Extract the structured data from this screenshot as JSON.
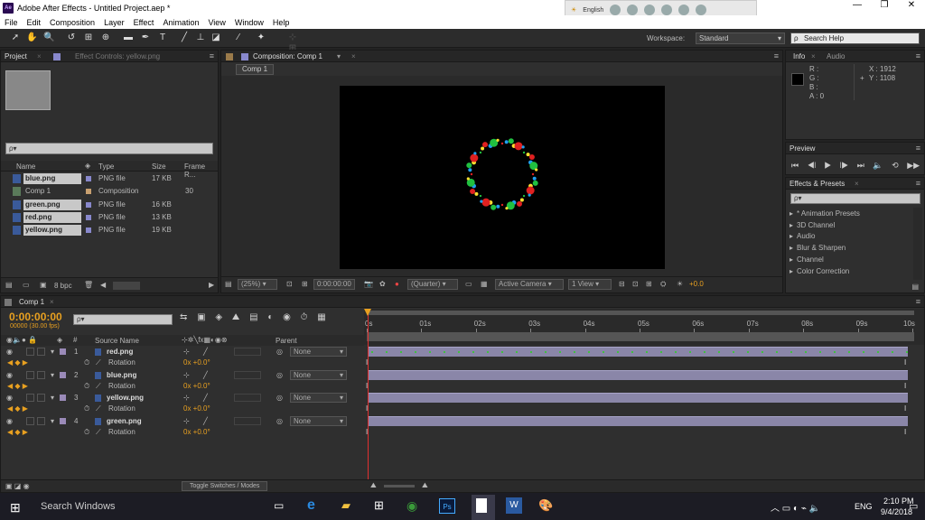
{
  "window": {
    "title": "Adobe After Effects - Untitled Project.aep *",
    "app_icon": "Ae"
  },
  "lang_bar": {
    "language": "English"
  },
  "menu": [
    "File",
    "Edit",
    "Composition",
    "Layer",
    "Effect",
    "Animation",
    "View",
    "Window",
    "Help"
  ],
  "toolbar": {
    "workspace_label": "Workspace:",
    "workspace_value": "Standard",
    "search_help": "Search Help"
  },
  "project_panel": {
    "tab_project": "Project",
    "tab_effect_controls": "Effect Controls: yellow.png",
    "search_placeholder": "ρ▾",
    "columns": {
      "name": "Name",
      "type": "Type",
      "size": "Size",
      "frame_rate": "Frame R..."
    },
    "items": [
      {
        "name": "blue.png",
        "type": "PNG file",
        "size": "17 KB",
        "fr": ""
      },
      {
        "name": "Comp 1",
        "type": "Composition",
        "size": "",
        "fr": "30"
      },
      {
        "name": "green.png",
        "type": "PNG file",
        "size": "16 KB",
        "fr": ""
      },
      {
        "name": "red.png",
        "type": "PNG file",
        "size": "13 KB",
        "fr": ""
      },
      {
        "name": "yellow.png",
        "type": "PNG file",
        "size": "19 KB",
        "fr": ""
      }
    ],
    "bpc": "8 bpc"
  },
  "comp_panel": {
    "tab": "Composition: Comp 1",
    "sub_tab": "Comp 1",
    "zoom": "(25%)",
    "timecode": "0:00:00:00",
    "resolution": "(Quarter)",
    "camera": "Active Camera",
    "view": "1 View",
    "exposure": "+0.0"
  },
  "info_panel": {
    "tab_info": "Info",
    "tab_audio": "Audio",
    "r": "R :",
    "g": "G :",
    "b": "B :",
    "a": "A : 0",
    "x": "X : 1912",
    "y": "Y : 1108"
  },
  "preview_panel": {
    "tab": "Preview"
  },
  "effects_panel": {
    "tab": "Effects & Presets",
    "search_placeholder": "ρ▾",
    "items": [
      "* Animation Presets",
      "3D Channel",
      "Audio",
      "Blur & Sharpen",
      "Channel",
      "Color Correction"
    ]
  },
  "timeline": {
    "tab": "Comp 1",
    "timecode": "0:00:00:00",
    "frame_info": "00000 (30.00 fps)",
    "search_placeholder": "ρ▾",
    "col_source": "Source Name",
    "col_parent": "Parent",
    "ruler": [
      "0s",
      "01s",
      "02s",
      "03s",
      "04s",
      "05s",
      "06s",
      "07s",
      "08s",
      "09s",
      "10s"
    ],
    "layers": [
      {
        "num": "1",
        "name": "red.png",
        "prop": "Rotation",
        "value": "0x +0.0°",
        "parent": "None",
        "color": "#9a8ab8"
      },
      {
        "num": "2",
        "name": "blue.png",
        "prop": "Rotation",
        "value": "0x +0.0°",
        "parent": "None",
        "color": "#9a8ab8"
      },
      {
        "num": "3",
        "name": "yellow.png",
        "prop": "Rotation",
        "value": "0x +0.0°",
        "parent": "None",
        "color": "#9a8ab8"
      },
      {
        "num": "4",
        "name": "green.png",
        "prop": "Rotation",
        "value": "0x +0.0°",
        "parent": "None",
        "color": "#9a8ab8"
      }
    ],
    "toggle_label": "Toggle Switches / Modes"
  },
  "taskbar": {
    "search": "Search Windows",
    "lang": "ENG",
    "time": "2:10 PM",
    "date": "9/4/2018"
  },
  "colors": {
    "accent": "#e8a020",
    "layer_bar": "#8a86a8"
  }
}
